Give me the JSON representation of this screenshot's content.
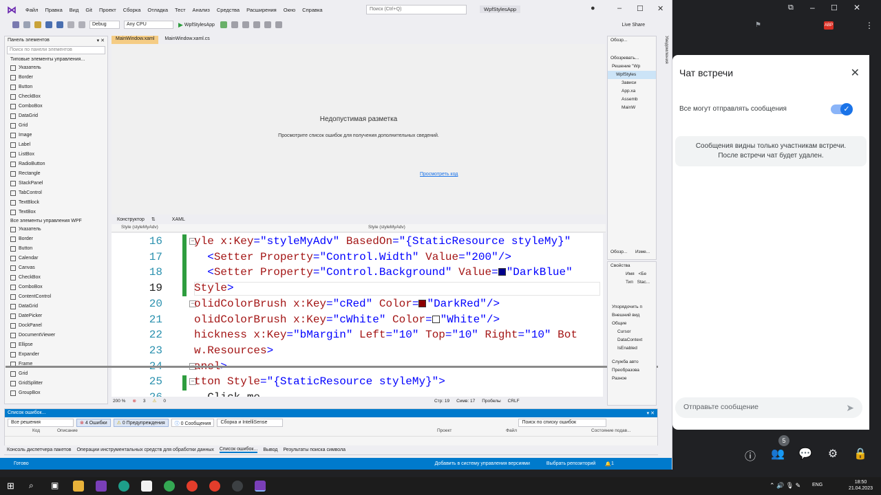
{
  "vs": {
    "menu": [
      "Файл",
      "Правка",
      "Вид",
      "Git",
      "Проект",
      "Сборка",
      "Отладка",
      "Тест",
      "Анализ",
      "Средства",
      "Расширения",
      "Окно",
      "Справка"
    ],
    "search_placeholder": "Поиск (Ctrl+Q)",
    "app_name": "WpfStylesApp",
    "toolbar": {
      "config": "Debug",
      "platform": "Any CPU",
      "run_label": "WpfStylesApp",
      "live_share": "Live Share"
    },
    "toolbox": {
      "title": "Панель элементов",
      "search_placeholder": "Поиск по панели элементов",
      "section_common": "Типовые элементы управления...",
      "common_items": [
        "Указатель",
        "Border",
        "Button",
        "CheckBox",
        "ComboBox",
        "DataGrid",
        "Grid",
        "Image",
        "Label",
        "ListBox",
        "RadioButton",
        "Rectangle",
        "StackPanel",
        "TabControl",
        "TextBlock",
        "TextBox"
      ],
      "section_all": "Все элементы управления WPF",
      "all_items": [
        "Указатель",
        "Border",
        "Button",
        "Calendar",
        "Canvas",
        "CheckBox",
        "ComboBox",
        "ContentControl",
        "DataGrid",
        "DatePicker",
        "DockPanel",
        "DocumentViewer",
        "Ellipse",
        "Expander",
        "Frame",
        "Grid",
        "GridSplitter",
        "GroupBox"
      ]
    },
    "tabs": [
      "MainWindow.xaml",
      "MainWindow.xaml.cs"
    ],
    "designer": {
      "title": "Недопустимая разметка",
      "subtitle": "Просмотрите список ошибок для получения дополнительных сведений.",
      "link": "Просмотреть код"
    },
    "split": {
      "designer": "Конструктор",
      "xaml": "XAML"
    },
    "scope_left": "Style (styleMyAdv)",
    "scope_right": "Style (styleMyAdv)",
    "code_lines": [
      {
        "n": "16",
        "t": "yle x:Key=\"styleMyAdv\" BasedOn=\"{StaticResource styleMy}\""
      },
      {
        "n": "17",
        "t": "  <Setter Property=\"Control.Width\" Value=\"200\"/>"
      },
      {
        "n": "18",
        "t": "  <Setter Property=\"Control.Background\" Value=\"DarkBlue\""
      },
      {
        "n": "19",
        "t": "Style>"
      },
      {
        "n": "20",
        "t": "olidColorBrush x:Key=\"cRed\" Color=\"DarkRed\"/>"
      },
      {
        "n": "21",
        "t": "olidColorBrush x:Key=\"cWhite\" Color=\"White\"/>"
      },
      {
        "n": "22",
        "t": "hickness x:Key=\"bMargin\" Left=\"10\" Top=\"10\" Right=\"10\" Bot"
      },
      {
        "n": "23",
        "t": "w.Resources>"
      },
      {
        "n": "24",
        "t": "anel>"
      },
      {
        "n": "25",
        "t": "tton Style=\"{StaticResource styleMy}\">"
      },
      {
        "n": "26",
        "t": "Click me"
      }
    ],
    "swatch_colors": {
      "darkblue": "#00008b",
      "darkred": "#8b0000",
      "white": "#ffffff"
    },
    "editor_status": {
      "zoom": "200 %",
      "errors": "3",
      "warnings": "0",
      "line": "Стр: 19",
      "col": "Симв: 17",
      "spaces": "Пробелы",
      "eol": "CRLF"
    },
    "solution": {
      "title": "Обозр...",
      "search": "Обозревать...",
      "items": [
        "Решение \"Wp",
        "WpfStyles",
        "Зависи",
        "App.xa",
        "Assemb",
        "MainW"
      ],
      "tabs": [
        "Обозр...",
        "Изме..."
      ]
    },
    "properties": {
      "title": "Свойства",
      "name_label": "Имя",
      "name_value": "<Бе",
      "type_label": "Тип",
      "type_value": "Stac...",
      "rows": [
        "Упорядочить п",
        "Внешний вид",
        "Общие",
        "Cursor",
        "DataContext",
        "IsEnabled",
        "Служба авто",
        "Преобразова",
        "Разное"
      ]
    },
    "side_strip": "Уведомления",
    "errors": {
      "title": "Список ошибок...",
      "scope": "Все решения",
      "errors_btn": "4 Ошибки",
      "warn_btn": "0 Предупреждения",
      "msg_btn": "0 Сообщения",
      "build": "Сборка и IntelliSense",
      "search": "Поиск по списку ошибок",
      "cols": [
        "Код",
        "Описание",
        "Проект",
        "Файл",
        "Состояние подав..."
      ]
    },
    "bottom_tabs": [
      "Консоль диспетчера пакетов",
      "Операции инструментальных средств для обработки данных",
      "Список ошибок...",
      "Вывод",
      "Результаты поиска символа"
    ],
    "status": {
      "ready": "Готово",
      "vcs": "Добавить в систему управления версиями",
      "repo": "Выбрать репозиторий",
      "bell_count": "1"
    }
  },
  "chat": {
    "title": "Чат встречи",
    "toggle_label": "Все могут отправлять сообщения",
    "toggle_on": true,
    "info_line1": "Сообщения видны только участникам встречи.",
    "info_line2": "После встречи чат будет удален.",
    "input_placeholder": "Отправьте сообщение",
    "participants_badge": "5"
  },
  "taskbar": {
    "lang": "ENG",
    "time": "18:50",
    "date": "21.04.2023"
  }
}
